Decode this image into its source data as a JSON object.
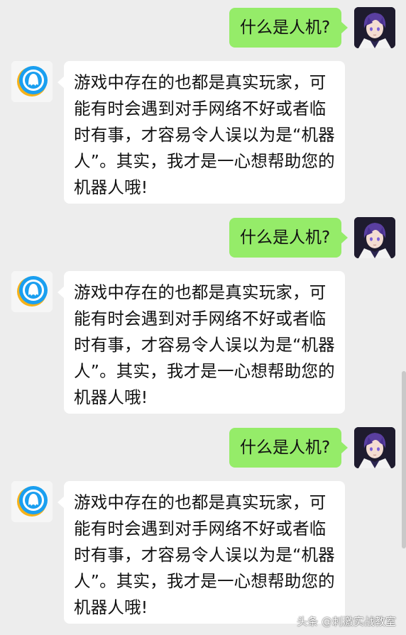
{
  "messages": [
    {
      "sender": "user",
      "text": "什么是人机?"
    },
    {
      "sender": "bot",
      "text": "游戏中存在的也都是真实玩家，可能有时会遇到对手网络不好或者临时有事，才容易令人误以为是“机器人”。其实，我才是一心想帮助您的机器人哦!"
    },
    {
      "sender": "user",
      "text": "什么是人机?"
    },
    {
      "sender": "bot",
      "text": "游戏中存在的也都是真实玩家，可能有时会遇到对手网络不好或者临时有事，才容易令人误以为是“机器人”。其实，我才是一心想帮助您的机器人哦!"
    },
    {
      "sender": "user",
      "text": "什么是人机?"
    },
    {
      "sender": "bot",
      "text": "游戏中存在的也都是真实玩家，可能有时会遇到对手网络不好或者临时有事，才容易令人误以为是“机器人”。其实，我才是一心想帮助您的机器人哦!"
    }
  ],
  "watermark": "头条 @刺激实战教室",
  "colors": {
    "background": "#ededed",
    "user_bubble": "#95ec69",
    "bot_bubble": "#ffffff",
    "bot_icon_blue": "#1a9ff0",
    "bot_icon_yellow": "#f6b21a"
  },
  "icons": {
    "bot_avatar": "qq-service-bot-icon",
    "user_avatar": "anime-character-avatar"
  }
}
